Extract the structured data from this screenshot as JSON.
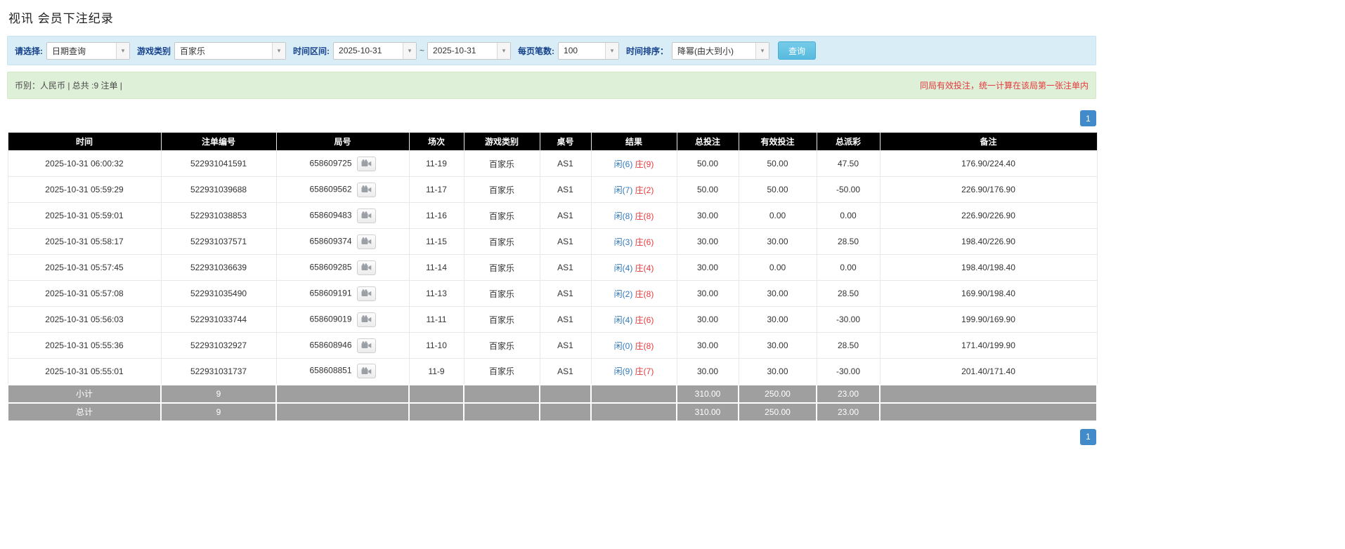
{
  "page": {
    "title": "视讯 会员下注纪录"
  },
  "filters": {
    "query_type_label": "请选择:",
    "query_type_value": "日期查询",
    "game_type_label": "游戏类别",
    "game_type_value": "百家乐",
    "date_range_label": "时间区间:",
    "date_from": "2025-10-31",
    "tilde": "~",
    "date_to": "2025-10-31",
    "page_size_label": "每页笔数:",
    "page_size_value": "100",
    "sort_label": "时间排序：",
    "sort_value": "降幂(由大到小)",
    "search_button": "查询"
  },
  "info_bar": {
    "left": "币别：人民币 | 总共 :9 注单 |",
    "right": "同局有效投注，统一计算在该局第一张注单内"
  },
  "pagination": {
    "page": "1"
  },
  "icons": {
    "dropdown_arrow": "▾",
    "video_icon": "video-camera"
  },
  "table": {
    "headers": [
      "时间",
      "注单编号",
      "局号",
      "场次",
      "游戏类别",
      "桌号",
      "结果",
      "总投注",
      "有效投注",
      "总派彩",
      "备注"
    ],
    "rows": [
      {
        "time": "2025-10-31 06:00:32",
        "bet_id": "522931041591",
        "round_id": "658609725",
        "session": "11-19",
        "game": "百家乐",
        "table_no": "AS1",
        "result_player": "闲(6)",
        "result_banker": "庄(9)",
        "total_bet": "50.00",
        "valid_bet": "50.00",
        "payout": "47.50",
        "remark": "176.90/224.40"
      },
      {
        "time": "2025-10-31 05:59:29",
        "bet_id": "522931039688",
        "round_id": "658609562",
        "session": "11-17",
        "game": "百家乐",
        "table_no": "AS1",
        "result_player": "闲(7)",
        "result_banker": "庄(2)",
        "total_bet": "50.00",
        "valid_bet": "50.00",
        "payout": "-50.00",
        "remark": "226.90/176.90"
      },
      {
        "time": "2025-10-31 05:59:01",
        "bet_id": "522931038853",
        "round_id": "658609483",
        "session": "11-16",
        "game": "百家乐",
        "table_no": "AS1",
        "result_player": "闲(8)",
        "result_banker": "庄(8)",
        "total_bet": "30.00",
        "valid_bet": "0.00",
        "payout": "0.00",
        "remark": "226.90/226.90"
      },
      {
        "time": "2025-10-31 05:58:17",
        "bet_id": "522931037571",
        "round_id": "658609374",
        "session": "11-15",
        "game": "百家乐",
        "table_no": "AS1",
        "result_player": "闲(3)",
        "result_banker": "庄(6)",
        "total_bet": "30.00",
        "valid_bet": "30.00",
        "payout": "28.50",
        "remark": "198.40/226.90"
      },
      {
        "time": "2025-10-31 05:57:45",
        "bet_id": "522931036639",
        "round_id": "658609285",
        "session": "11-14",
        "game": "百家乐",
        "table_no": "AS1",
        "result_player": "闲(4)",
        "result_banker": "庄(4)",
        "total_bet": "30.00",
        "valid_bet": "0.00",
        "payout": "0.00",
        "remark": "198.40/198.40"
      },
      {
        "time": "2025-10-31 05:57:08",
        "bet_id": "522931035490",
        "round_id": "658609191",
        "session": "11-13",
        "game": "百家乐",
        "table_no": "AS1",
        "result_player": "闲(2)",
        "result_banker": "庄(8)",
        "total_bet": "30.00",
        "valid_bet": "30.00",
        "payout": "28.50",
        "remark": "169.90/198.40"
      },
      {
        "time": "2025-10-31 05:56:03",
        "bet_id": "522931033744",
        "round_id": "658609019",
        "session": "11-11",
        "game": "百家乐",
        "table_no": "AS1",
        "result_player": "闲(4)",
        "result_banker": "庄(6)",
        "total_bet": "30.00",
        "valid_bet": "30.00",
        "payout": "-30.00",
        "remark": "199.90/169.90"
      },
      {
        "time": "2025-10-31 05:55:36",
        "bet_id": "522931032927",
        "round_id": "658608946",
        "session": "11-10",
        "game": "百家乐",
        "table_no": "AS1",
        "result_player": "闲(0)",
        "result_banker": "庄(8)",
        "total_bet": "30.00",
        "valid_bet": "30.00",
        "payout": "28.50",
        "remark": "171.40/199.90"
      },
      {
        "time": "2025-10-31 05:55:01",
        "bet_id": "522931031737",
        "round_id": "658608851",
        "session": "11-9",
        "game": "百家乐",
        "table_no": "AS1",
        "result_player": "闲(9)",
        "result_banker": "庄(7)",
        "total_bet": "30.00",
        "valid_bet": "30.00",
        "payout": "-30.00",
        "remark": "201.40/171.40"
      }
    ],
    "subtotal": {
      "label": "小计",
      "count": "9",
      "total_bet": "310.00",
      "valid_bet": "250.00",
      "payout": "23.00"
    },
    "total": {
      "label": "总计",
      "count": "9",
      "total_bet": "310.00",
      "valid_bet": "250.00",
      "payout": "23.00"
    }
  }
}
